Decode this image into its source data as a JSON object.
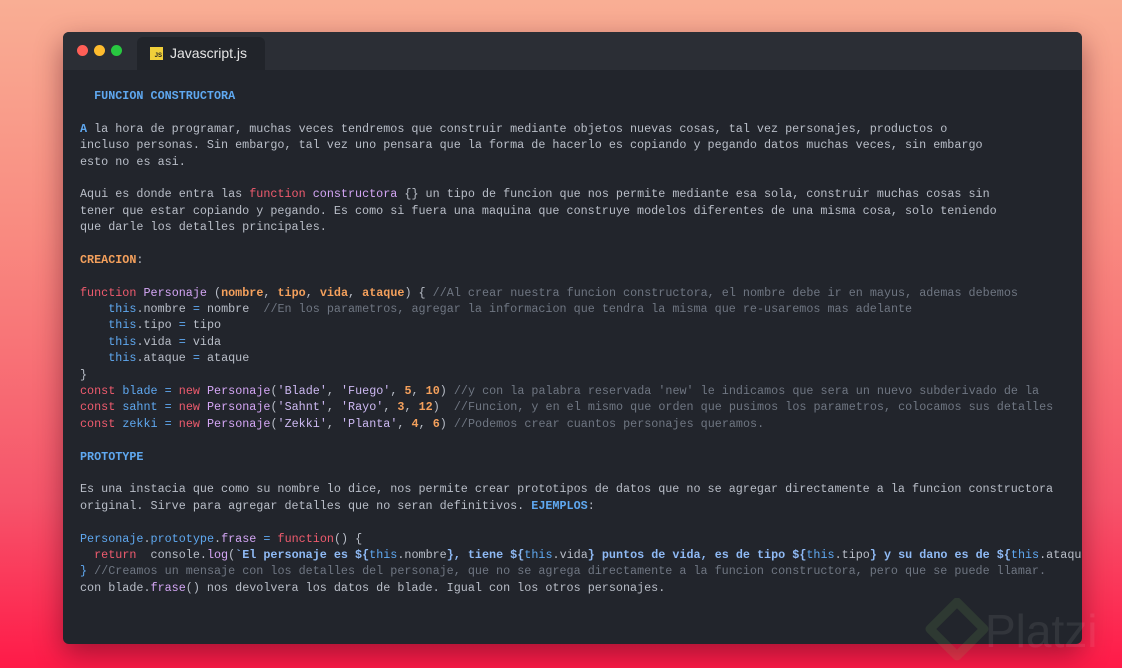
{
  "window": {
    "tab_label": "Javascript.js",
    "tab_icon": "js-file-icon",
    "tab_icon_text": "JS",
    "traffic_lights": {
      "close": "#ff5f57",
      "minimize": "#febc2e",
      "maximize": "#28c840"
    }
  },
  "watermark": "Platzi",
  "lines": [
    [
      {
        "k": "hb",
        "t": "  FUNCION CONSTRUCTORA"
      }
    ],
    [],
    [
      {
        "k": "hb",
        "t": "A"
      },
      {
        "k": "p",
        "t": " la hora de programar, muchas veces tendremos que construir mediante objetos nuevas cosas, tal vez personajes, productos o"
      }
    ],
    [
      {
        "k": "p",
        "t": "incluso personas. Sin embargo, tal vez uno pensara que la forma de hacerlo es copiando y pegando datos muchas veces, sin embargo"
      }
    ],
    [
      {
        "k": "p",
        "t": "esto no es asi."
      }
    ],
    [],
    [
      {
        "k": "p",
        "t": "Aqui es donde entra las "
      },
      {
        "k": "k",
        "t": "function"
      },
      {
        "k": "p",
        "t": " "
      },
      {
        "k": "f",
        "t": "constructora"
      },
      {
        "k": "p",
        "t": " {} un tipo de funcion que nos permite mediante esa sola, construir muchas cosas sin"
      }
    ],
    [
      {
        "k": "p",
        "t": "tener que estar copiando y pegando. Es como si fuera una maquina que construye modelos diferentes de una misma cosa, solo teniendo"
      }
    ],
    [
      {
        "k": "p",
        "t": "que darle los detalles principales."
      }
    ],
    [],
    [
      {
        "k": "ha",
        "t": "CREACION"
      },
      {
        "k": "p",
        "t": ":"
      }
    ],
    [],
    [
      {
        "k": "k",
        "t": "function"
      },
      {
        "k": "p",
        "t": " "
      },
      {
        "k": "f",
        "t": "Personaje"
      },
      {
        "k": "p",
        "t": " ("
      },
      {
        "k": "a",
        "t": "nombre"
      },
      {
        "k": "p",
        "t": ", "
      },
      {
        "k": "a",
        "t": "tipo"
      },
      {
        "k": "p",
        "t": ", "
      },
      {
        "k": "a",
        "t": "vida"
      },
      {
        "k": "p",
        "t": ", "
      },
      {
        "k": "a",
        "t": "ataque"
      },
      {
        "k": "p",
        "t": ") { "
      },
      {
        "k": "c",
        "t": "//Al crear nuestra funcion constructora, el nombre debe ir en mayus, ademas debemos"
      }
    ],
    [
      {
        "k": "p",
        "t": "    "
      },
      {
        "k": "b",
        "t": "this"
      },
      {
        "k": "p",
        "t": ".nombre "
      },
      {
        "k": "b",
        "t": "="
      },
      {
        "k": "p",
        "t": " nombre  "
      },
      {
        "k": "c",
        "t": "//En los parametros, agregar la informacion que tendra la misma que re-usaremos mas adelante"
      }
    ],
    [
      {
        "k": "p",
        "t": "    "
      },
      {
        "k": "b",
        "t": "this"
      },
      {
        "k": "p",
        "t": ".tipo "
      },
      {
        "k": "b",
        "t": "="
      },
      {
        "k": "p",
        "t": " tipo"
      }
    ],
    [
      {
        "k": "p",
        "t": "    "
      },
      {
        "k": "b",
        "t": "this"
      },
      {
        "k": "p",
        "t": ".vida "
      },
      {
        "k": "b",
        "t": "="
      },
      {
        "k": "p",
        "t": " vida"
      }
    ],
    [
      {
        "k": "p",
        "t": "    "
      },
      {
        "k": "b",
        "t": "this"
      },
      {
        "k": "p",
        "t": ".ataque "
      },
      {
        "k": "b",
        "t": "="
      },
      {
        "k": "p",
        "t": " ataque"
      }
    ],
    [
      {
        "k": "p",
        "t": "}"
      }
    ],
    [
      {
        "k": "k",
        "t": "const"
      },
      {
        "k": "p",
        "t": " "
      },
      {
        "k": "b",
        "t": "blade"
      },
      {
        "k": "p",
        "t": " "
      },
      {
        "k": "b",
        "t": "="
      },
      {
        "k": "p",
        "t": " "
      },
      {
        "k": "k",
        "t": "new"
      },
      {
        "k": "p",
        "t": " "
      },
      {
        "k": "f",
        "t": "Personaje"
      },
      {
        "k": "p",
        "t": "("
      },
      {
        "k": "s",
        "t": "'Blade'"
      },
      {
        "k": "p",
        "t": ", "
      },
      {
        "k": "s",
        "t": "'Fuego'"
      },
      {
        "k": "p",
        "t": ", "
      },
      {
        "k": "a",
        "t": "5"
      },
      {
        "k": "p",
        "t": ", "
      },
      {
        "k": "a",
        "t": "10"
      },
      {
        "k": "p",
        "t": ") "
      },
      {
        "k": "c",
        "t": "//y con la palabra reservada 'new' le indicamos que sera un nuevo subderivado de la"
      }
    ],
    [
      {
        "k": "k",
        "t": "const"
      },
      {
        "k": "p",
        "t": " "
      },
      {
        "k": "b",
        "t": "sahnt"
      },
      {
        "k": "p",
        "t": " "
      },
      {
        "k": "b",
        "t": "="
      },
      {
        "k": "p",
        "t": " "
      },
      {
        "k": "k",
        "t": "new"
      },
      {
        "k": "p",
        "t": " "
      },
      {
        "k": "f",
        "t": "Personaje"
      },
      {
        "k": "p",
        "t": "("
      },
      {
        "k": "s",
        "t": "'Sahnt'"
      },
      {
        "k": "p",
        "t": ", "
      },
      {
        "k": "s",
        "t": "'Rayo'"
      },
      {
        "k": "p",
        "t": ", "
      },
      {
        "k": "a",
        "t": "3"
      },
      {
        "k": "p",
        "t": ", "
      },
      {
        "k": "a",
        "t": "12"
      },
      {
        "k": "p",
        "t": ")  "
      },
      {
        "k": "c",
        "t": "//Funcion, y en el mismo que orden que pusimos los parametros, colocamos sus detalles"
      }
    ],
    [
      {
        "k": "k",
        "t": "const"
      },
      {
        "k": "p",
        "t": " "
      },
      {
        "k": "b",
        "t": "zekki"
      },
      {
        "k": "p",
        "t": " "
      },
      {
        "k": "b",
        "t": "="
      },
      {
        "k": "p",
        "t": " "
      },
      {
        "k": "k",
        "t": "new"
      },
      {
        "k": "p",
        "t": " "
      },
      {
        "k": "f",
        "t": "Personaje"
      },
      {
        "k": "p",
        "t": "("
      },
      {
        "k": "s",
        "t": "'Zekki'"
      },
      {
        "k": "p",
        "t": ", "
      },
      {
        "k": "s",
        "t": "'Planta'"
      },
      {
        "k": "p",
        "t": ", "
      },
      {
        "k": "a",
        "t": "4"
      },
      {
        "k": "p",
        "t": ", "
      },
      {
        "k": "a",
        "t": "6"
      },
      {
        "k": "p",
        "t": ") "
      },
      {
        "k": "c",
        "t": "//Podemos crear cuantos personajes queramos."
      }
    ],
    [],
    [
      {
        "k": "hb",
        "t": "PROTOTYPE"
      }
    ],
    [],
    [
      {
        "k": "p",
        "t": "Es una instacia que como su nombre lo dice, nos permite crear prototipos de datos que no se agregar directamente a la funcion constructora"
      }
    ],
    [
      {
        "k": "p",
        "t": "original. Sirve para agregar detalles que no seran definitivos. "
      },
      {
        "k": "hb",
        "t": "EJEMPLOS"
      },
      {
        "k": "p",
        "t": ":"
      }
    ],
    [],
    [
      {
        "k": "b",
        "t": "Personaje"
      },
      {
        "k": "p",
        "t": "."
      },
      {
        "k": "b",
        "t": "prototype"
      },
      {
        "k": "p",
        "t": "."
      },
      {
        "k": "f",
        "t": "frase"
      },
      {
        "k": "p",
        "t": " "
      },
      {
        "k": "b",
        "t": "="
      },
      {
        "k": "p",
        "t": " "
      },
      {
        "k": "k",
        "t": "function"
      },
      {
        "k": "p",
        "t": "() {"
      }
    ],
    [
      {
        "k": "p",
        "t": "  "
      },
      {
        "k": "k",
        "t": "return"
      },
      {
        "k": "p",
        "t": "  console."
      },
      {
        "k": "f",
        "t": "log"
      },
      {
        "k": "p",
        "t": "("
      },
      {
        "k": "t",
        "t": "`El personaje es ${"
      },
      {
        "k": "b",
        "t": "this"
      },
      {
        "k": "p",
        "t": ".nombre"
      },
      {
        "k": "t",
        "t": "}, tiene ${"
      },
      {
        "k": "b",
        "t": "this"
      },
      {
        "k": "p",
        "t": ".vida"
      },
      {
        "k": "t",
        "t": "} puntos de vida, es de tipo ${"
      },
      {
        "k": "b",
        "t": "this"
      },
      {
        "k": "p",
        "t": ".tipo"
      },
      {
        "k": "t",
        "t": "} y su dano es de ${"
      },
      {
        "k": "b",
        "t": "this"
      },
      {
        "k": "p",
        "t": ".ataque"
      }
    ],
    [
      {
        "k": "b",
        "t": "}"
      },
      {
        "k": "p",
        "t": " "
      },
      {
        "k": "c",
        "t": "//Creamos un mensaje con los detalles del personaje, que no se agrega directamente a la funcion constructora, pero que se puede llamar."
      }
    ],
    [
      {
        "k": "p",
        "t": "con blade."
      },
      {
        "k": "f",
        "t": "frase"
      },
      {
        "k": "p",
        "t": "() nos devolvera los datos de blade. Igual con los otros personajes."
      }
    ]
  ]
}
